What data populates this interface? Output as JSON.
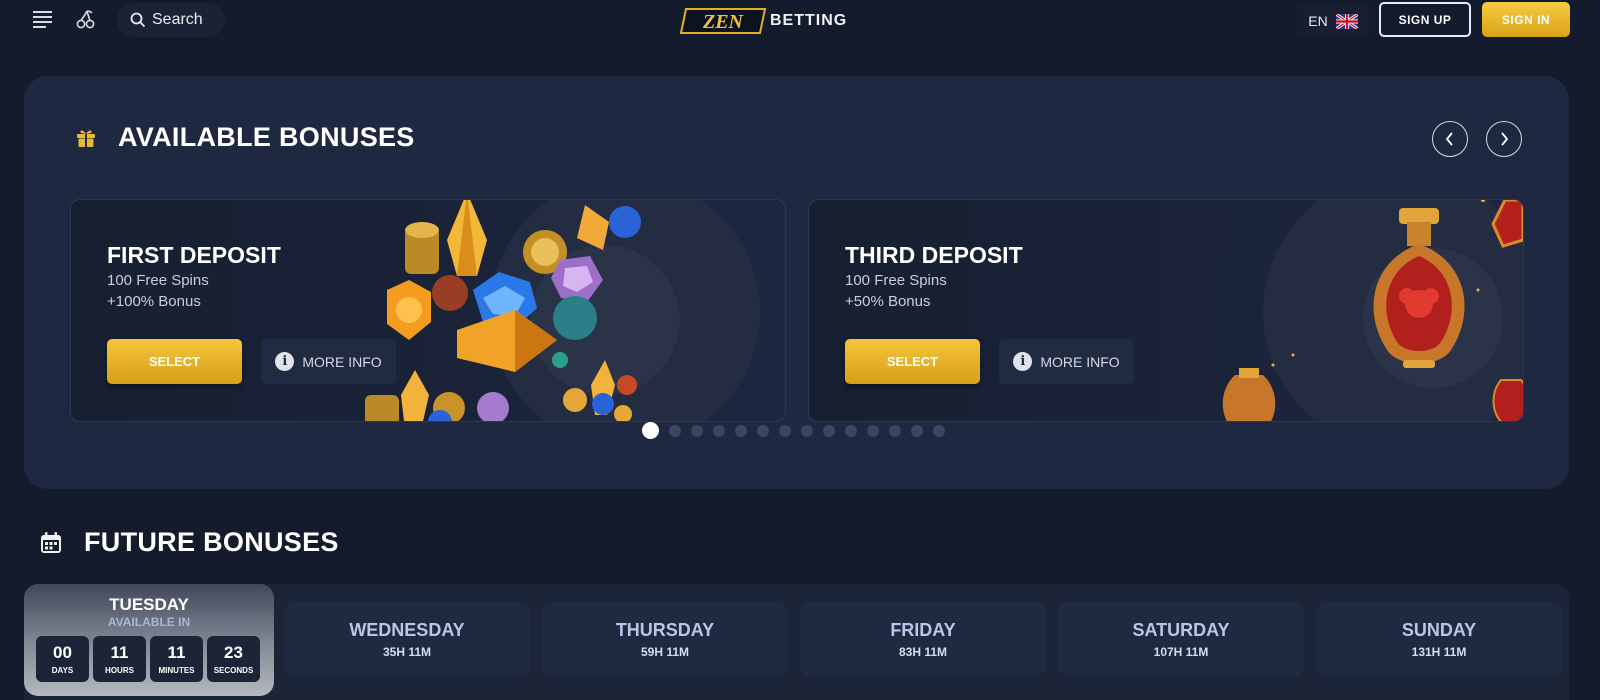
{
  "header": {
    "search_label": "Search",
    "logo_mark": "ZEN",
    "logo_text": "BETTING",
    "language": "EN",
    "signup_label": "SIGN UP",
    "signin_label": "SIGN IN"
  },
  "available": {
    "title": "AVAILABLE BONUSES",
    "cards": [
      {
        "title": "FIRST DEPOSIT",
        "line1": "100 Free Spins",
        "line2": "+100% Bonus",
        "select_label": "SELECT",
        "info_label": "MORE INFO"
      },
      {
        "title": "THIRD DEPOSIT",
        "line1": "100 Free Spins",
        "line2": "+50% Bonus",
        "select_label": "SELECT",
        "info_label": "MORE INFO"
      }
    ],
    "pagination": {
      "total": 14,
      "active": 1
    }
  },
  "future": {
    "title": "FUTURE BONUSES",
    "today": {
      "day": "TUESDAY",
      "status": "AVAILABLE IN",
      "countdown": [
        {
          "value": "00",
          "unit": "DAYS"
        },
        {
          "value": "11",
          "unit": "HOURS"
        },
        {
          "value": "11",
          "unit": "MINUTES"
        },
        {
          "value": "23",
          "unit": "SECONDS"
        }
      ]
    },
    "days": [
      {
        "day": "WEDNESDAY",
        "time": "35H 11M"
      },
      {
        "day": "THURSDAY",
        "time": "59H 11M"
      },
      {
        "day": "FRIDAY",
        "time": "83H 11M"
      },
      {
        "day": "SATURDAY",
        "time": "107H 11M"
      },
      {
        "day": "SUNDAY",
        "time": "131H 11M"
      }
    ]
  },
  "colors": {
    "background": "#141b2c",
    "panel": "#1e2840",
    "gold": "#f4c63d",
    "day_label": "#b6c7e8"
  },
  "icons": [
    "menu-icon",
    "cherry-icon",
    "search-icon",
    "uk-flag-icon",
    "gift-icon",
    "chevron-left-icon",
    "chevron-right-icon",
    "info-icon",
    "calendar-icon"
  ]
}
